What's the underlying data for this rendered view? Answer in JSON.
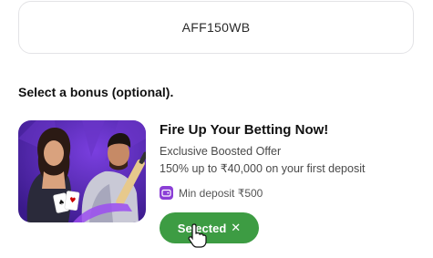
{
  "promo": {
    "code": "AFF150WB"
  },
  "section": {
    "title": "Select a bonus (optional)."
  },
  "bonus": {
    "title": "Fire Up Your Betting Now!",
    "subtitle": "Exclusive Boosted Offer",
    "description": "150% up to ₹40,000 on your first deposit",
    "min_deposit": "Min deposit ₹500",
    "button_label": "Selected",
    "button_icon": "close-icon"
  },
  "colors": {
    "accent_green": "#3d9c43",
    "icon_purple": "#8b3fd6",
    "image_bg_purple": "#5a2bb0"
  }
}
